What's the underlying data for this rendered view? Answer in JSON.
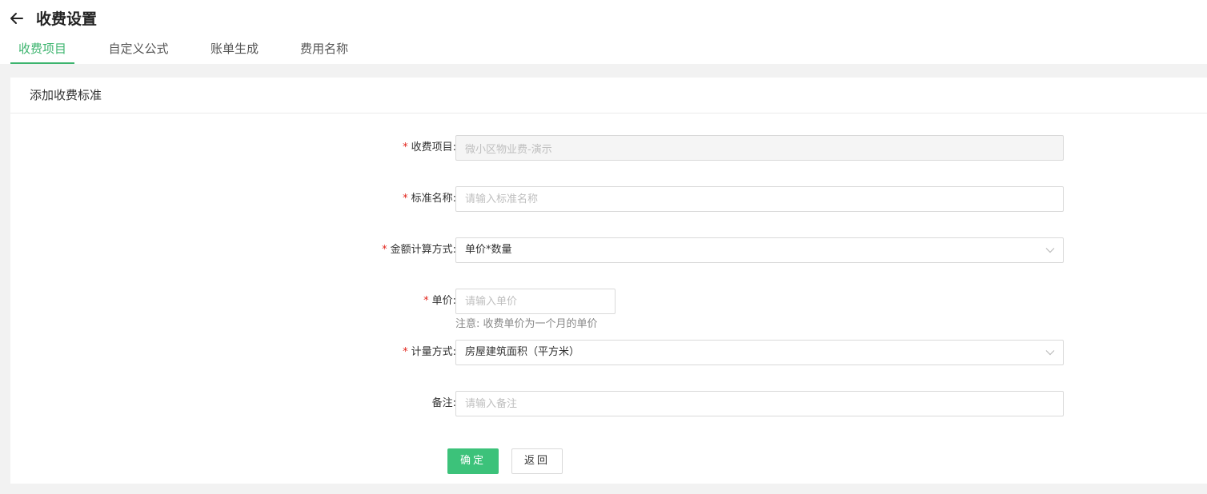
{
  "header": {
    "back_icon": "arrow-left-icon",
    "title": "收费设置"
  },
  "tabs": [
    {
      "label": "收费项目",
      "active": true
    },
    {
      "label": "自定义公式",
      "active": false
    },
    {
      "label": "账单生成",
      "active": false
    },
    {
      "label": "费用名称",
      "active": false
    }
  ],
  "card": {
    "title": "添加收费标准"
  },
  "form": {
    "required_mark": "*",
    "charge_item": {
      "label": "收费项目:",
      "value": "微小区物业费-演示"
    },
    "standard_name": {
      "label": "标准名称:",
      "placeholder": "请输入标准名称"
    },
    "amount_method": {
      "label": "金额计算方式:",
      "value": "单价*数量",
      "icon": "chevron-down-icon"
    },
    "unit_price": {
      "label": "单价:",
      "placeholder": "请输入单价",
      "hint": "注意: 收费单价为一个月的单价"
    },
    "measure_method": {
      "label": "计量方式:",
      "value": "房屋建筑面积（平方米）",
      "icon": "chevron-down-icon"
    },
    "remark": {
      "label": "备注:",
      "placeholder": "请输入备注"
    }
  },
  "buttons": {
    "confirm": "确定",
    "back": "返回"
  },
  "colors": {
    "accent": "#3cb46e",
    "primary_button": "#3cc27a",
    "required": "#e2231a"
  }
}
